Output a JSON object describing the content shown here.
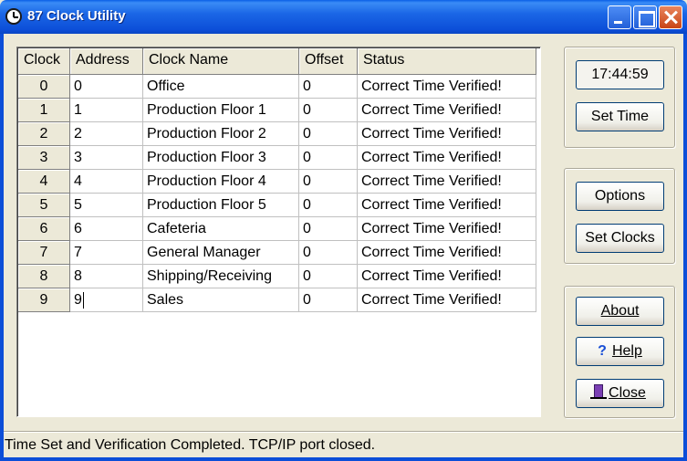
{
  "window": {
    "title": "87 Clock Utility"
  },
  "grid": {
    "columns": [
      "Clock",
      "Address",
      "Clock Name",
      "Offset",
      "Status"
    ],
    "rows": [
      {
        "clock": "0",
        "address": "0",
        "name": "Office",
        "offset": "0",
        "status": "Correct Time Verified!"
      },
      {
        "clock": "1",
        "address": "1",
        "name": "Production Floor 1",
        "offset": "0",
        "status": "Correct Time Verified!"
      },
      {
        "clock": "2",
        "address": "2",
        "name": "Production Floor 2",
        "offset": "0",
        "status": "Correct Time Verified!"
      },
      {
        "clock": "3",
        "address": "3",
        "name": "Production Floor 3",
        "offset": "0",
        "status": "Correct Time Verified!"
      },
      {
        "clock": "4",
        "address": "4",
        "name": "Production Floor 4",
        "offset": "0",
        "status": "Correct Time Verified!"
      },
      {
        "clock": "5",
        "address": "5",
        "name": "Production Floor 5",
        "offset": "0",
        "status": "Correct Time Verified!"
      },
      {
        "clock": "6",
        "address": "6",
        "name": "Cafeteria",
        "offset": "0",
        "status": "Correct Time Verified!"
      },
      {
        "clock": "7",
        "address": "7",
        "name": "General Manager",
        "offset": "0",
        "status": "Correct Time Verified!"
      },
      {
        "clock": "8",
        "address": "8",
        "name": "Shipping/Receiving",
        "offset": "0",
        "status": "Correct Time Verified!"
      },
      {
        "clock": "9",
        "address": "9",
        "name": "Sales",
        "offset": "0",
        "status": "Correct Time Verified!"
      }
    ]
  },
  "time_group": {
    "current_time": "17:44:59",
    "set_time_label": "Set Time"
  },
  "clocks_group": {
    "options_label": "Options",
    "set_clocks_label": "Set Clocks"
  },
  "help_group": {
    "about_label": "About",
    "help_label": "Help",
    "close_label": "Close",
    "help_icon": "question-mark-icon",
    "close_icon": "exit-door-icon"
  },
  "status_bar": {
    "text": "Time Set and Verification Completed. TCP/IP port closed."
  },
  "colors": {
    "title_bar": "#0c4ed8",
    "face": "#ece9d8",
    "grid_bg": "#ffffff",
    "close_button": "#c94515"
  }
}
